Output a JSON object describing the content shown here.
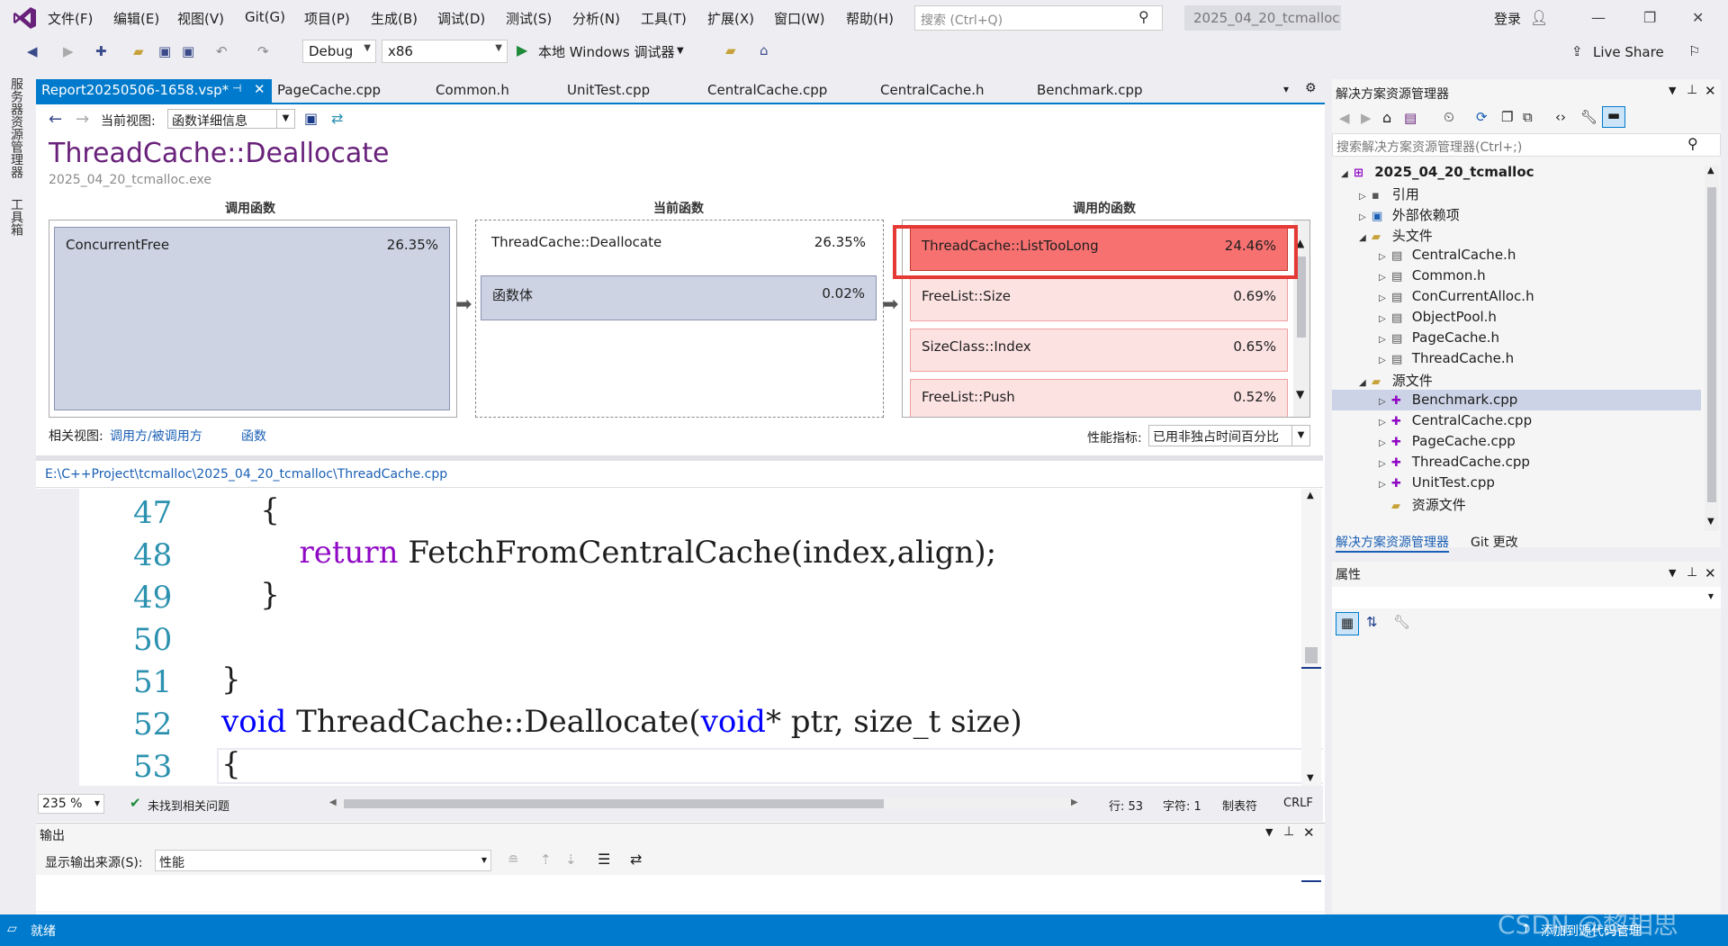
{
  "menubar": {
    "items": [
      "文件(F)",
      "编辑(E)",
      "视图(V)",
      "Git(G)",
      "项目(P)",
      "生成(B)",
      "调试(D)",
      "测试(S)",
      "分析(N)",
      "工具(T)",
      "扩展(X)",
      "窗口(W)",
      "帮助(H)"
    ],
    "search_placeholder": "搜索 (Ctrl+Q)",
    "solution_title": "2025_04_20_tcmalloc",
    "login": "登录"
  },
  "toolbar": {
    "config": "Debug",
    "platform": "x86",
    "debugger": "本地 Windows 调试器",
    "live_share": "Live Share"
  },
  "left_strip": {
    "server_explorer": "服务器资源管理器",
    "toolbox": "工具箱"
  },
  "doc_tabs": [
    "Report20250506-1658.vsp*",
    "PageCache.cpp",
    "Common.h",
    "UnitTest.cpp",
    "CentralCache.cpp",
    "CentralCache.h",
    "Benchmark.cpp"
  ],
  "report": {
    "view_label": "当前视图:",
    "view_value": "函数详细信息",
    "title": "ThreadCache::Deallocate",
    "subtitle": "2025_04_20_tcmalloc.exe",
    "callers_head": "调用函数",
    "current_head": "当前函数",
    "callees_head": "调用的函数",
    "callers": [
      {
        "name": "ConcurrentFree",
        "pct": "26.35%"
      }
    ],
    "current": {
      "name": "ThreadCache::Deallocate",
      "pct": "26.35%",
      "body_name": "函数体",
      "body_pct": "0.02%"
    },
    "callees": [
      {
        "name": "ThreadCache::ListTooLong",
        "pct": "24.46%"
      },
      {
        "name": "FreeList::Size",
        "pct": "0.69%"
      },
      {
        "name": "SizeClass::Index",
        "pct": "0.65%"
      },
      {
        "name": "FreeList::Push",
        "pct": "0.52%"
      }
    ],
    "related_label": "相关视图:",
    "related_link1": "调用方/被调用方",
    "related_link2": "函数",
    "metric_label": "性能指标:",
    "metric_value": "已用非独占时间百分比"
  },
  "editor": {
    "file_path": "E:\\C++Project\\tcmalloc\\2025_04_20_tcmalloc\\ThreadCache.cpp",
    "lines": [
      {
        "num": "47",
        "code": "    {"
      },
      {
        "num": "48",
        "code": "        return FetchFromCentralCache(index,align);"
      },
      {
        "num": "49",
        "code": "    }"
      },
      {
        "num": "50",
        "code": ""
      },
      {
        "num": "51",
        "code": "}"
      },
      {
        "num": "52",
        "code": "void ThreadCache::Deallocate(void* ptr, size_t size)"
      },
      {
        "num": "53",
        "code": "{"
      }
    ],
    "zoom": "235 %",
    "issues": "未找到相关问题",
    "line_info": "行: 53",
    "char_info": "字符: 1",
    "tab_info": "制表符",
    "eol": "CRLF"
  },
  "solution_explorer": {
    "title": "解决方案资源管理器",
    "search_placeholder": "搜索解决方案资源管理器(Ctrl+;)",
    "project": "2025_04_20_tcmalloc",
    "nodes": {
      "references": "引用",
      "external": "外部依赖项",
      "headers": "头文件",
      "header_files": [
        "CentralCache.h",
        "Common.h",
        "ConCurrentAlloc.h",
        "ObjectPool.h",
        "PageCache.h",
        "ThreadCache.h"
      ],
      "sources": "源文件",
      "source_files": [
        "Benchmark.cpp",
        "CentralCache.cpp",
        "PageCache.cpp",
        "ThreadCache.cpp",
        "UnitTest.cpp"
      ],
      "resources": "资源文件"
    },
    "bottom_tabs": [
      "解决方案资源管理器",
      "Git 更改"
    ]
  },
  "properties": {
    "title": "属性"
  },
  "output": {
    "title": "输出",
    "source_label": "显示输出来源(S):",
    "source_value": "性能"
  },
  "status": {
    "ready": "就绪",
    "add_source": "添加到源代码管理",
    "watermark": "CSDN @黎相思"
  },
  "colors": {
    "accent": "#007acc",
    "hot": "#f87171",
    "purple_title": "#68217a"
  }
}
